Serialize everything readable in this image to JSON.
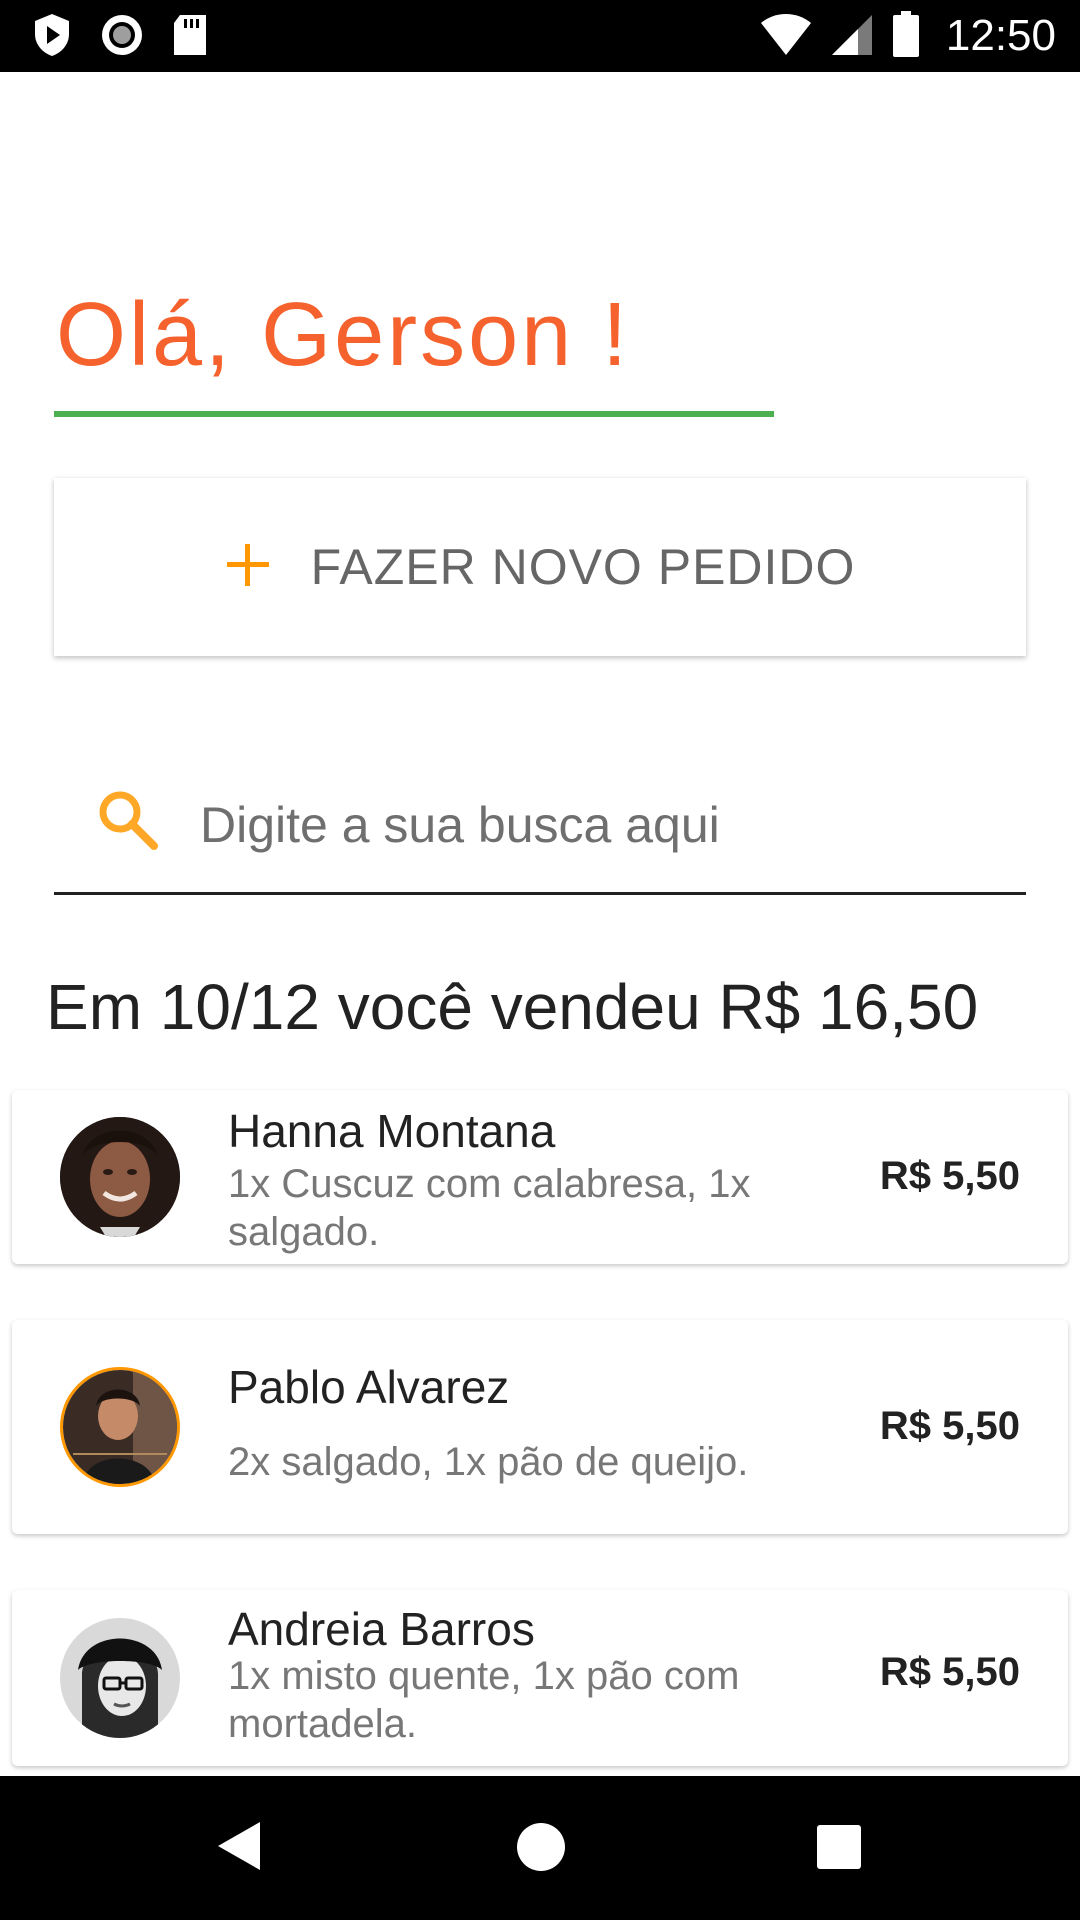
{
  "status_bar": {
    "time": "12:50",
    "left_icons": [
      "play-protect-icon",
      "record-icon",
      "sd-card-icon"
    ],
    "right_icons": [
      "wifi-icon",
      "signal-icon",
      "battery-icon"
    ]
  },
  "greeting": "Olá, Gerson !",
  "new_order": {
    "icon": "plus-icon",
    "label": "FAZER NOVO PEDIDO"
  },
  "search": {
    "icon": "search-icon",
    "placeholder": "Digite a sua busca aqui",
    "value": ""
  },
  "summary": "Em 10/12 você vendeu R$ 16,50",
  "orders": [
    {
      "name": "Hanna Montana",
      "items": "1x Cuscuz com calabresa, 1x salgado.",
      "price": "R$ 5,50"
    },
    {
      "name": "Pablo Alvarez",
      "items": "2x salgado, 1x pão de queijo.",
      "price": "R$ 5,50"
    },
    {
      "name": "Andreia Barros",
      "items": "1x misto quente, 1x pão com mortadela.",
      "price": "R$ 5,50"
    }
  ],
  "nav_bar": {
    "buttons": [
      "back-icon",
      "home-icon",
      "recents-icon"
    ]
  },
  "colors": {
    "greeting": "#f5622d",
    "underline": "#4caf50",
    "accent_orange": "#ff9800",
    "search_icon": "#ffa726"
  }
}
